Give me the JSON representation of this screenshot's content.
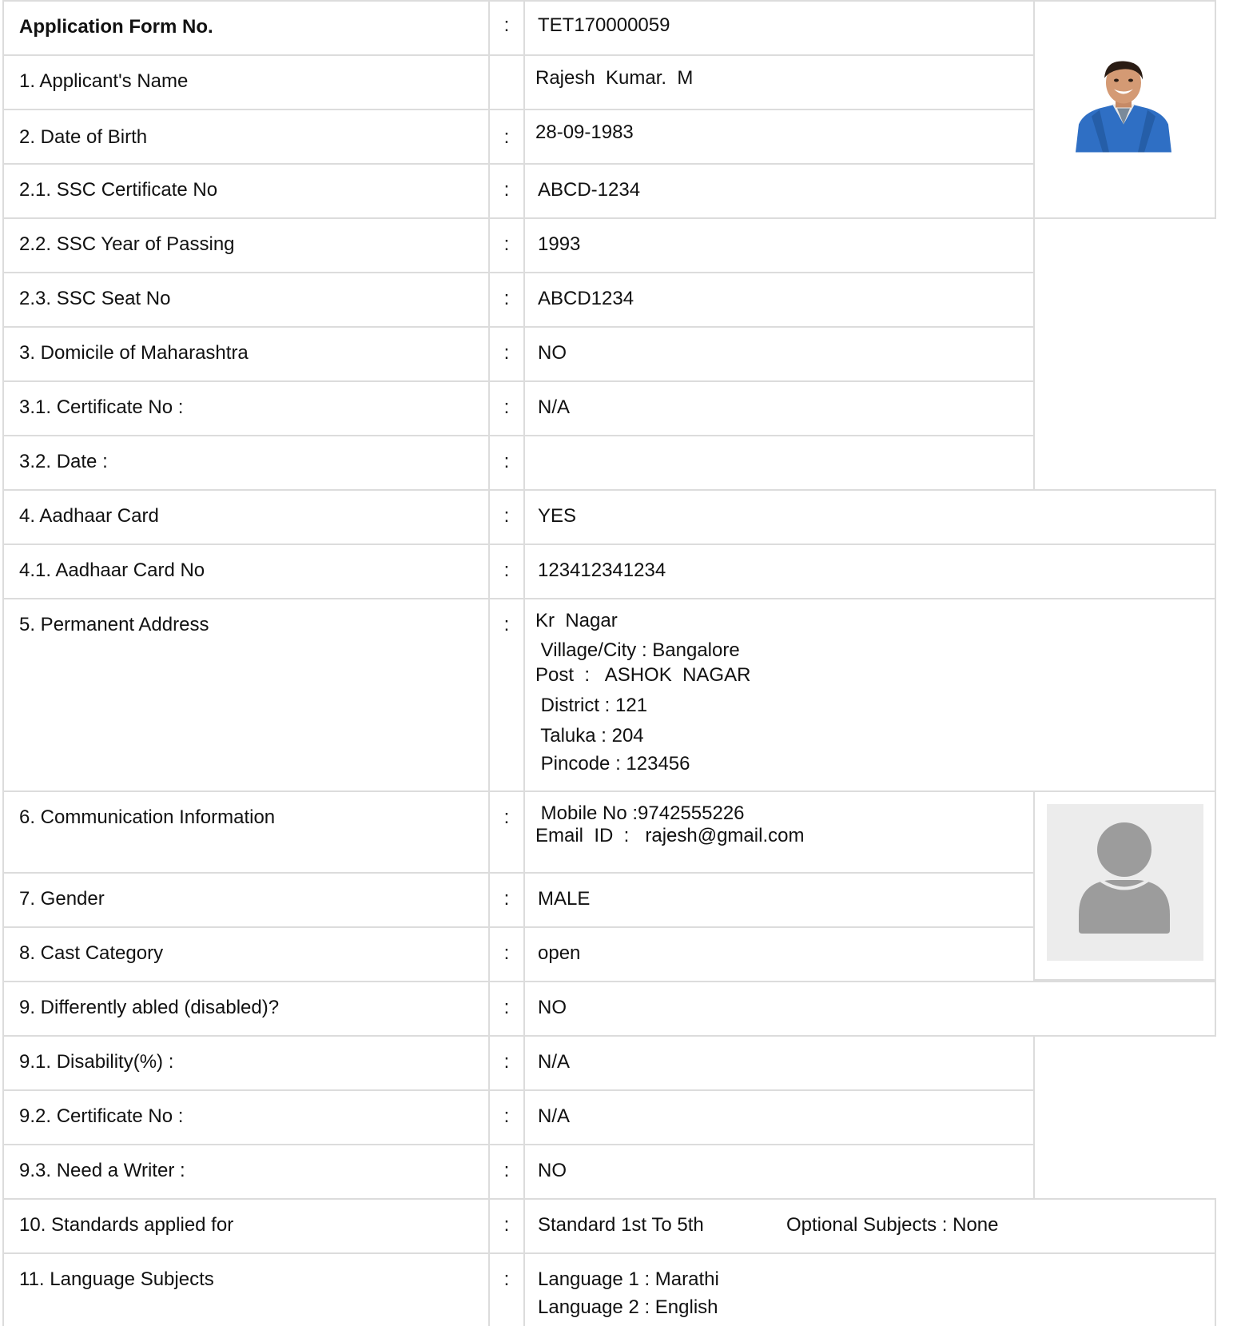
{
  "rows": [
    {
      "label": "Application Form No.",
      "sep": ":",
      "value": "TET170000059"
    },
    {
      "label": "1. Applicant's Name",
      "sep": "",
      "value": "Rajesh  Kumar.  M"
    },
    {
      "label": "2. Date of Birth",
      "sep": ":",
      "value": "28-09-1983"
    },
    {
      "label": "2.1. SSC Certificate No",
      "sep": ":",
      "value": "ABCD-1234"
    },
    {
      "label": "2.2. SSC Year of Passing",
      "sep": ":",
      "value": "1993"
    },
    {
      "label": "2.3. SSC Seat No",
      "sep": ":",
      "value": "ABCD1234"
    },
    {
      "label": "3. Domicile of Maharashtra",
      "sep": ":",
      "value": "NO"
    },
    {
      "label": "3.1. Certificate No :",
      "sep": ":",
      "value": "N/A"
    },
    {
      "label": "3.2. Date :",
      "sep": ":",
      "value": ""
    },
    {
      "label": "4. Aadhaar Card",
      "sep": ":",
      "value": "YES"
    },
    {
      "label": "4.1. Aadhaar Card No",
      "sep": ":",
      "value": "123412341234"
    },
    {
      "label": "5. Permanent Address",
      "sep": ":",
      "lines": [
        "Kr  Nagar",
        " Village/City : Bangalore",
        "Post  :   ASHOK  NAGAR",
        " District : 121",
        " Taluka : 204",
        " Pincode : 123456"
      ]
    },
    {
      "label": "6. Communication Information",
      "sep": ":",
      "lines": [
        " Mobile No :9742555226",
        "Email  ID  :   rajesh@gmail.com"
      ]
    },
    {
      "label": "7. Gender",
      "sep": ":",
      "value": "MALE"
    },
    {
      "label": "8. Cast Category",
      "sep": ":",
      "value": "open"
    },
    {
      "label": "9. Differently abled (disabled)?",
      "sep": ":",
      "value": "NO"
    },
    {
      "label": "9.1. Disability(%) :",
      "sep": ":",
      "value": "N/A"
    },
    {
      "label": "9.2. Certificate No :",
      "sep": ":",
      "value": "N/A"
    },
    {
      "label": "9.3. Need a Writer :",
      "sep": ":",
      "value": "NO"
    },
    {
      "label": "10. Standards applied for",
      "sep": ":",
      "value": "Standard 1st To 5th",
      "extra": "Optional Subjects : None"
    },
    {
      "label": "11. Language Subjects",
      "sep": ":",
      "lines": [
        "Language 1 : Marathi",
        "Language 2 : English"
      ]
    }
  ],
  "photos": {
    "applicant_photo": "applicant-photo",
    "signature_placeholder": "user-placeholder-icon"
  },
  "colors": {
    "border": "#dcdcdc",
    "placeholder_bg": "#ececec",
    "placeholder_icon": "#9c9c9c",
    "shirt": "#2f6fc4"
  }
}
